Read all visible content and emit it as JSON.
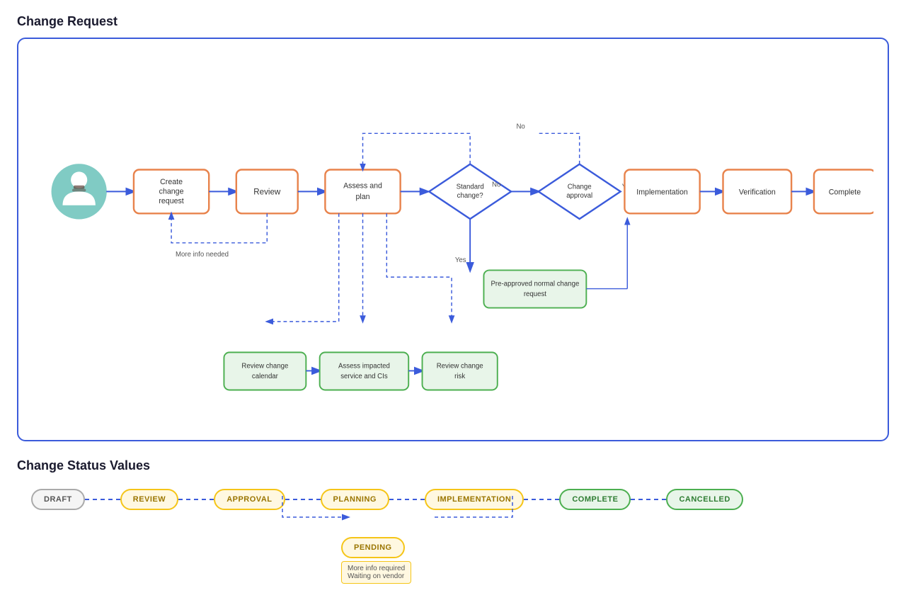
{
  "page": {
    "diagram_title": "Change Request",
    "status_title": "Change Status Values"
  },
  "nodes": {
    "actor_label": "Actor",
    "create_change_request": "Create change request",
    "review": "Review",
    "assess_and_plan": "Assess and plan",
    "standard_change": "Standard change?",
    "change_approval": "Change approval",
    "implementation": "Implementation",
    "verification": "Verification",
    "complete": "Complete",
    "more_info_needed": "More info needed",
    "pre_approved": "Pre-approved normal change request",
    "review_change_calendar": "Review change calendar",
    "assess_impacted": "Assess impacted service and CIs",
    "review_change_risk": "Review change risk",
    "no_label_1": "No",
    "no_label_2": "No",
    "yes_label_1": "Yes",
    "yes_label_2": "Yes"
  },
  "status_values": [
    {
      "label": "DRAFT",
      "color": "#e0e0e0",
      "border": "#999",
      "text": "#555"
    },
    {
      "label": "REVIEW",
      "color": "#fff8e1",
      "border": "#f5c518",
      "text": "#9a7500"
    },
    {
      "label": "APPROVAL",
      "color": "#fff8e1",
      "border": "#f5c518",
      "text": "#9a7500"
    },
    {
      "label": "PLANNING",
      "color": "#fff8e1",
      "border": "#f5c518",
      "text": "#9a7500"
    },
    {
      "label": "IMPLEMENTATION",
      "color": "#fff8e1",
      "border": "#f5c518",
      "text": "#9a7500"
    },
    {
      "label": "COMPLETE",
      "color": "#e8f5e9",
      "border": "#4caf50",
      "text": "#2e7d32"
    },
    {
      "label": "CANCELLED",
      "color": "#e8f5e9",
      "border": "#4caf50",
      "text": "#2e7d32"
    }
  ],
  "pending_badge": {
    "label": "PENDING",
    "color": "#fff8e1",
    "border": "#f5c518",
    "text": "#9a7500",
    "sub_text_1": "More info required",
    "sub_text_2": "Waiting on vendor"
  },
  "colors": {
    "orange_border": "#e8834c",
    "blue_border": "#3b5bdb",
    "green_border": "#4caf50",
    "green_fill": "#e8f5e9",
    "dashed": "#3b5bdb"
  }
}
